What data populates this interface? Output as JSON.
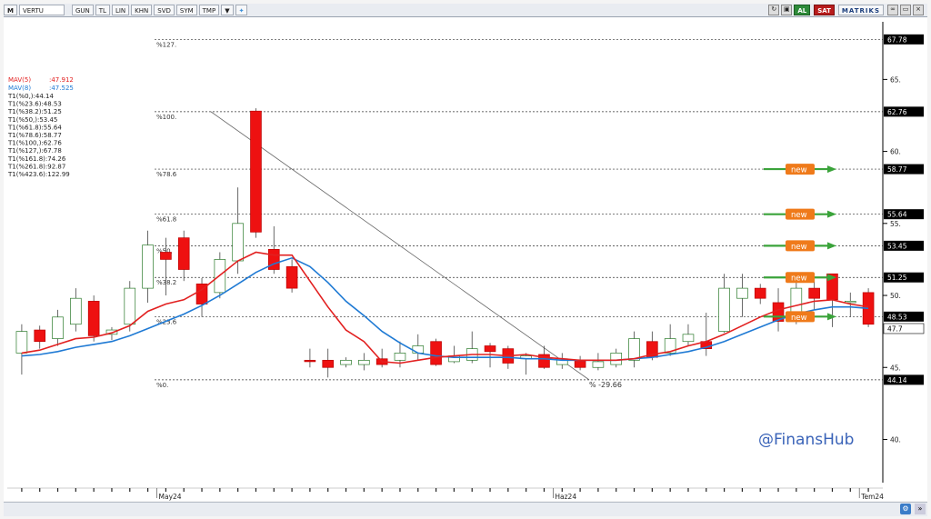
{
  "toolbar": {
    "m_label": "M",
    "symbol": "VERTU",
    "buttons": [
      "GUN",
      "TL",
      "LIN",
      "KHN",
      "SVD",
      "SYM",
      "TMP"
    ],
    "al_label": "AL",
    "sat_label": "SAT",
    "brand": "MATRIKS"
  },
  "legend": {
    "mav5": "MAV(5)",
    "mav5_value": ":47.912",
    "mav8": "MAV(8)",
    "mav8_value": ":47.525",
    "fib_lines": [
      "T1(%0,):44.14",
      "T1(%23.6):48.53",
      "T1(%38.2):51.25",
      "T1(%50,):53.45",
      "T1(%61.8):55.64",
      "T1(%78.6):58.77",
      "T1(%100,):62.76",
      "T1(%127,):67.78",
      "T1(%161.8):74.26",
      "T1(%261.8):92.87",
      "T1(%423.6):122.99"
    ]
  },
  "watermark": "@FinansHub",
  "new_badge": "new",
  "colors": {
    "up": "#ffffff",
    "down": "#ee1111",
    "mav5": "#e22020",
    "mav8": "#1f7ad4",
    "badge": "#ef7a1a",
    "arrow": "#3aa33a",
    "price_box": "#000000"
  },
  "chart_data": {
    "type": "candlestick",
    "ylim": [
      37.0,
      69.0
    ],
    "yticks": [
      40,
      45,
      50,
      55,
      60,
      65
    ],
    "ytick_labels": [
      "40.",
      "45.",
      "50.",
      "55.",
      "60.",
      "65."
    ],
    "xlabels": [
      {
        "label": "May24",
        "index": 8
      },
      {
        "label": "Haz24",
        "index": 30
      },
      {
        "label": "Tem24",
        "index": 47
      }
    ],
    "fib_levels": [
      {
        "price": 67.78,
        "label": "%127.",
        "axis": "67.78",
        "boxed": true
      },
      {
        "price": 62.76,
        "label": "%100.",
        "axis": "62.76",
        "boxed": true
      },
      {
        "price": 58.77,
        "label": "%78.6",
        "axis": "58.77",
        "boxed": true,
        "new": true
      },
      {
        "price": 55.64,
        "label": "%61.8",
        "axis": "55.64",
        "boxed": true,
        "new": true
      },
      {
        "price": 53.45,
        "label": "%50.",
        "axis": "53.45",
        "boxed": true,
        "new": true
      },
      {
        "price": 51.25,
        "label": "%38.2",
        "axis": "51.25",
        "boxed": true,
        "new": true
      },
      {
        "price": 48.53,
        "label": "%23.6",
        "axis": "48.53",
        "boxed": true,
        "new": true
      },
      {
        "price": 44.14,
        "label": "%0.",
        "axis": "44.14",
        "boxed": true
      }
    ],
    "last_price": {
      "value": 47.7,
      "label": "47.7"
    },
    "trend_line": {
      "from_index": 10.5,
      "from_price": 62.76,
      "to_index": 31.5,
      "to_price": 44.14,
      "label": "% -29.66"
    },
    "candles": [
      [
        46.0,
        47.5,
        44.5,
        48.0
      ],
      [
        47.6,
        46.8,
        46.3,
        47.9
      ],
      [
        47.0,
        48.5,
        46.5,
        49.0
      ],
      [
        48.0,
        49.8,
        47.5,
        50.5
      ],
      [
        49.6,
        47.2,
        46.8,
        50.0
      ],
      [
        47.3,
        47.6,
        46.9,
        47.8
      ],
      [
        48.0,
        50.5,
        47.5,
        51.0
      ],
      [
        50.5,
        53.5,
        49.5,
        54.5
      ],
      [
        53.0,
        52.5,
        50.0,
        54.0
      ],
      [
        54.0,
        51.8,
        51.0,
        54.5
      ],
      [
        50.8,
        49.4,
        48.5,
        51.2
      ],
      [
        50.2,
        52.5,
        49.8,
        53.0
      ],
      [
        52.4,
        55.0,
        51.5,
        57.5
      ],
      [
        62.8,
        54.4,
        54.0,
        63.0
      ],
      [
        53.2,
        51.8,
        51.5,
        54.8
      ],
      [
        52.0,
        50.5,
        50.2,
        52.5
      ],
      [
        45.5,
        45.4,
        45.0,
        46.3
      ],
      [
        45.5,
        45.0,
        44.3,
        46.3
      ],
      [
        45.2,
        45.5,
        45.0,
        45.7
      ],
      [
        45.2,
        45.5,
        44.8,
        46.0
      ],
      [
        45.6,
        45.2,
        45.0,
        46.3
      ],
      [
        45.5,
        46.0,
        45.0,
        46.8
      ],
      [
        46.0,
        46.5,
        45.5,
        47.3
      ],
      [
        46.8,
        45.2,
        45.1,
        47.0
      ],
      [
        45.4,
        45.8,
        45.3,
        46.5
      ],
      [
        45.5,
        46.3,
        45.3,
        47.5
      ],
      [
        46.5,
        46.1,
        45.0,
        46.7
      ],
      [
        46.3,
        45.3,
        44.9,
        46.5
      ],
      [
        45.6,
        45.8,
        44.5,
        46.0
      ],
      [
        45.9,
        45.0,
        44.9,
        46.5
      ],
      [
        45.2,
        45.6,
        44.9,
        46.0
      ],
      [
        45.5,
        45.0,
        44.8,
        45.8
      ],
      [
        45.0,
        45.4,
        44.8,
        46.0
      ],
      [
        45.2,
        46.0,
        45.0,
        46.3
      ],
      [
        45.5,
        47.0,
        45.0,
        47.5
      ],
      [
        46.8,
        45.7,
        45.5,
        47.5
      ],
      [
        46.0,
        47.0,
        45.8,
        48.0
      ],
      [
        46.8,
        47.3,
        46.5,
        48.0
      ],
      [
        46.8,
        46.3,
        45.8,
        48.8
      ],
      [
        47.5,
        50.5,
        47.4,
        51.5
      ],
      [
        49.8,
        50.5,
        48.5,
        51.5
      ],
      [
        50.5,
        49.8,
        49.4,
        50.8
      ],
      [
        49.5,
        48.2,
        47.5,
        50.5
      ],
      [
        48.5,
        50.5,
        48.0,
        51.0
      ],
      [
        50.5,
        49.8,
        49.0,
        51.5
      ],
      [
        51.5,
        49.7,
        47.8,
        51.5
      ],
      [
        49.5,
        49.6,
        48.5,
        50.2
      ],
      [
        50.2,
        48.0,
        47.8,
        50.5
      ]
    ],
    "mav5": [
      46.0,
      46.2,
      46.6,
      47.0,
      47.1,
      47.4,
      47.9,
      48.9,
      49.4,
      49.7,
      50.4,
      51.4,
      52.4,
      53.0,
      52.8,
      52.8,
      51.0,
      49.2,
      47.6,
      46.8,
      45.4,
      45.3,
      45.5,
      45.7,
      45.8,
      45.9,
      45.9,
      45.8,
      45.9,
      45.7,
      45.6,
      45.5,
      45.5,
      45.5,
      45.6,
      45.9,
      46.1,
      46.5,
      46.8,
      47.3,
      47.9,
      48.5,
      49.0,
      49.3,
      49.6,
      49.7,
      49.4,
      49.2
    ],
    "mav8": [
      45.8,
      45.9,
      46.1,
      46.4,
      46.6,
      46.8,
      47.2,
      47.7,
      48.2,
      48.7,
      49.3,
      50.0,
      50.8,
      51.6,
      52.2,
      52.6,
      52.0,
      50.9,
      49.6,
      48.6,
      47.5,
      46.7,
      46.0,
      45.8,
      45.7,
      45.7,
      45.7,
      45.7,
      45.6,
      45.6,
      45.5,
      45.5,
      45.5,
      45.5,
      45.6,
      45.7,
      45.9,
      46.1,
      46.4,
      46.8,
      47.3,
      47.8,
      48.3,
      48.7,
      49.0,
      49.2,
      49.2,
      49.1
    ]
  }
}
